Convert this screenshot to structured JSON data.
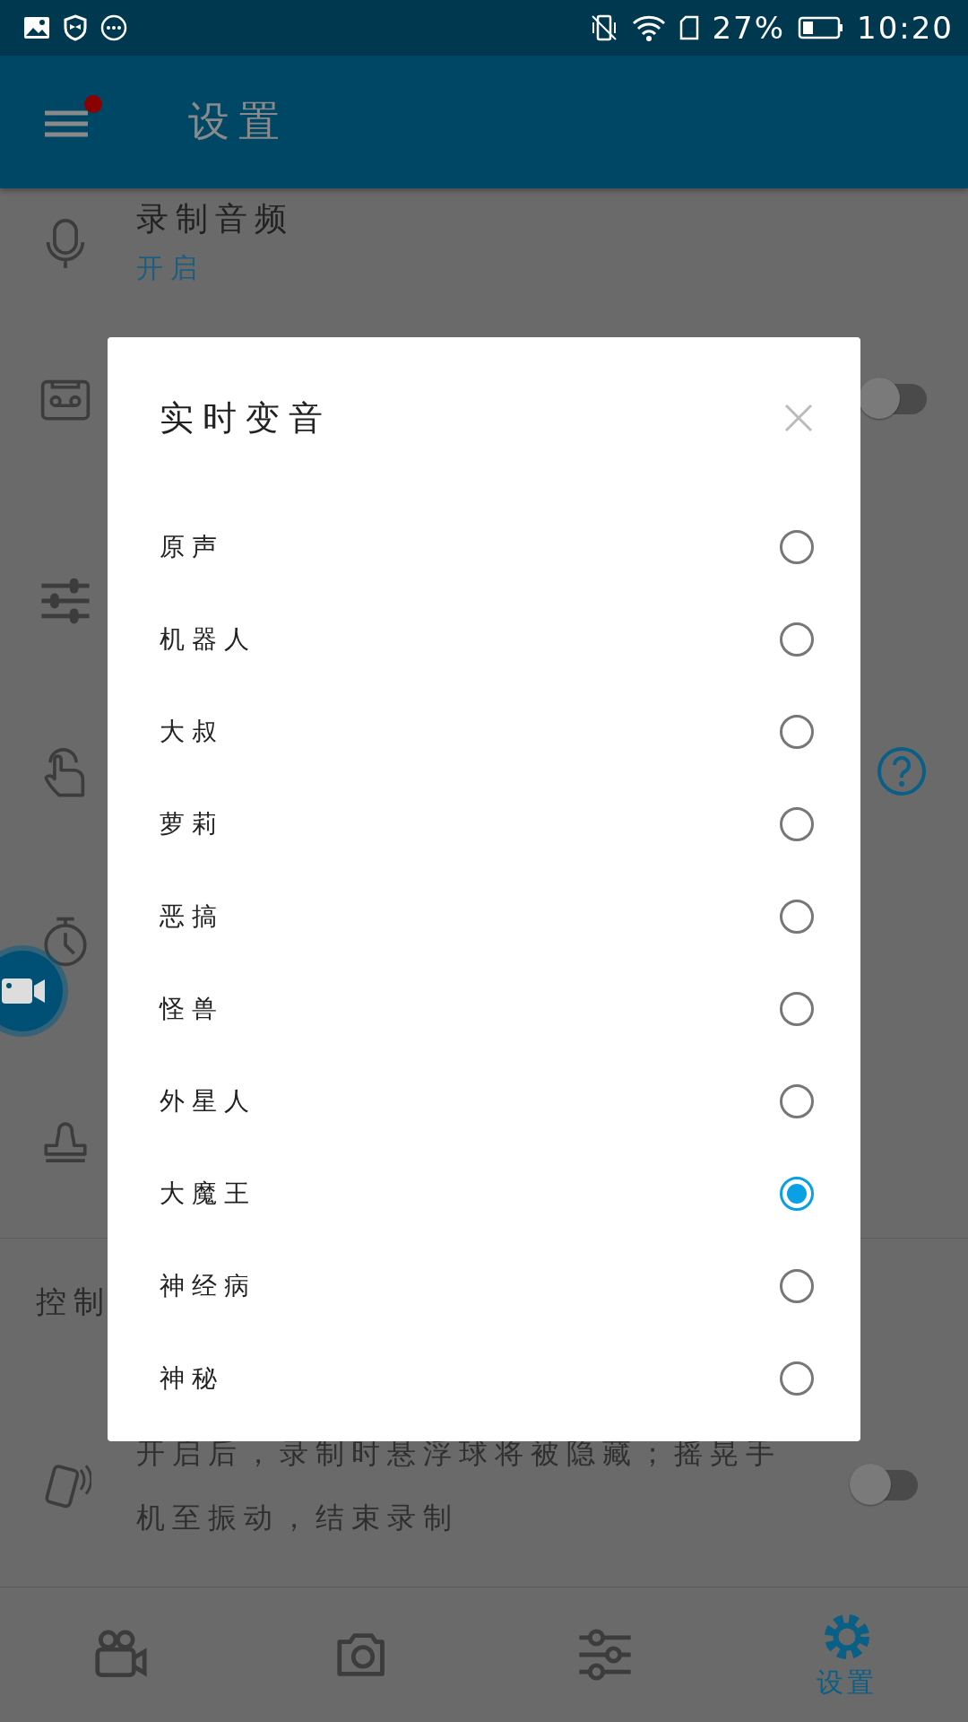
{
  "status_bar": {
    "battery_text": "27%",
    "time": "10:20"
  },
  "app_bar": {
    "title": "设置"
  },
  "settings": [
    {
      "kind": "text",
      "title": "录制音频",
      "value": "开启"
    },
    {
      "kind": "switch",
      "on": false
    },
    {
      "kind": "plain"
    },
    {
      "kind": "help"
    },
    {
      "kind": "plain"
    },
    {
      "kind": "plain"
    }
  ],
  "section": {
    "title": "控制",
    "rows": [
      {
        "kind": "switch",
        "description": "开启后，录制时悬浮球将被隐藏；摇晃手机至振动，结束录制",
        "on": false
      }
    ]
  },
  "dialog": {
    "title": "实时变音",
    "options": [
      {
        "label": "原声",
        "selected": false
      },
      {
        "label": "机器人",
        "selected": false
      },
      {
        "label": "大叔",
        "selected": false
      },
      {
        "label": "萝莉",
        "selected": false
      },
      {
        "label": "恶搞",
        "selected": false
      },
      {
        "label": "怪兽",
        "selected": false
      },
      {
        "label": "外星人",
        "selected": false
      },
      {
        "label": "大魔王",
        "selected": true
      },
      {
        "label": "神经病",
        "selected": false
      },
      {
        "label": "神秘",
        "selected": false
      }
    ]
  },
  "bottom_nav": [
    {
      "selected": false
    },
    {
      "selected": false
    },
    {
      "selected": false
    },
    {
      "selected": true,
      "label": "设置"
    }
  ]
}
